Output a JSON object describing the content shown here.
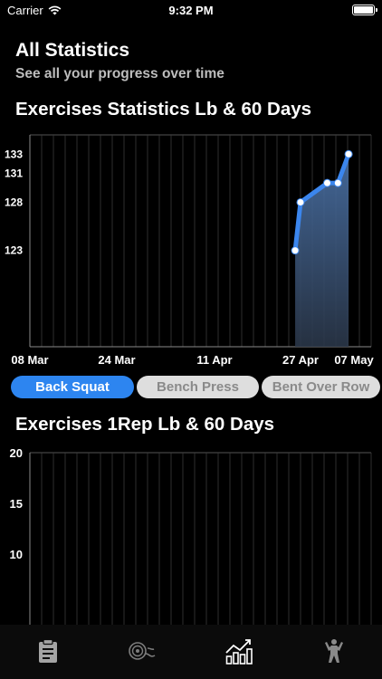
{
  "status": {
    "carrier": "Carrier",
    "time": "9:32 PM"
  },
  "header": {
    "title": "All Statistics",
    "subtitle": "See all your progress over time"
  },
  "sections": {
    "exercises_stats_title": "Exercises Statistics Lb & 60 Days",
    "one_rep_title": "Exercises 1Rep Lb & 60 Days"
  },
  "exercise_filters": [
    {
      "label": "Back Squat",
      "selected": true
    },
    {
      "label": "Bench Press",
      "selected": false
    },
    {
      "label": "Bent Over Row",
      "selected": false
    }
  ],
  "tabs": [
    {
      "icon": "clipboard-icon",
      "selected": false
    },
    {
      "icon": "weight-plate-icon",
      "selected": false
    },
    {
      "icon": "statistics-chart-icon",
      "selected": true
    },
    {
      "icon": "bodybuilder-icon",
      "selected": false
    }
  ],
  "colors": {
    "accent": "#2d85f0",
    "line": "#3b86ee",
    "chip_inactive_bg": "#dedede",
    "chip_inactive_text": "#8a8a8a"
  },
  "chart_data": [
    {
      "type": "area",
      "x_ticks": [
        "08 Mar",
        "24 Mar",
        "11 Apr",
        "27 Apr",
        "07 May"
      ],
      "y_ticks": [
        123,
        128,
        131,
        133
      ],
      "ylim": [
        113,
        135
      ],
      "grid": true,
      "series": [
        {
          "values": [
            {
              "x": "26 Apr",
              "y": 123
            },
            {
              "x": "27 Apr",
              "y": 128
            },
            {
              "x": "02 May",
              "y": 130
            },
            {
              "x": "04 May",
              "y": 130
            },
            {
              "x": "06 May",
              "y": 133
            }
          ]
        }
      ]
    },
    {
      "type": "line",
      "y_ticks": [
        10,
        15,
        20
      ],
      "ylim": [
        3,
        20
      ],
      "grid": true,
      "series": []
    }
  ]
}
